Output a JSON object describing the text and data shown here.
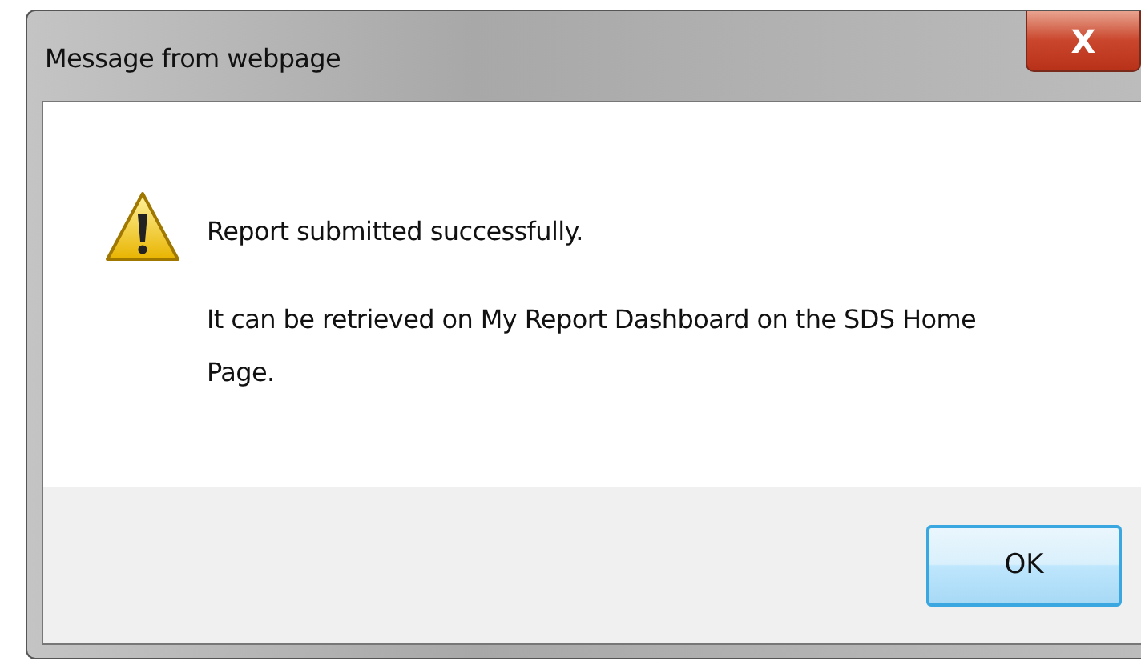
{
  "window": {
    "title": "Message from webpage",
    "close": "X"
  },
  "message": {
    "lines": [
      "Report submitted successfully.",
      "It can be retrieved on My Report Dashboard on the SDS Home Page."
    ]
  },
  "buttons": [
    {
      "label": "OK",
      "selected": true
    }
  ]
}
